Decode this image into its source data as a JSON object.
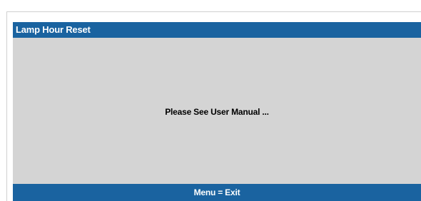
{
  "dialog": {
    "title": "Lamp Hour Reset",
    "message": "Please See User Manual ...",
    "footer_hint": "Menu = Exit"
  },
  "colors": {
    "title_bar": "#1a63a0",
    "content_background": "#d4d4d4",
    "footer_bar": "#1a63a0",
    "title_text": "#ffffff",
    "message_text": "#000000"
  }
}
